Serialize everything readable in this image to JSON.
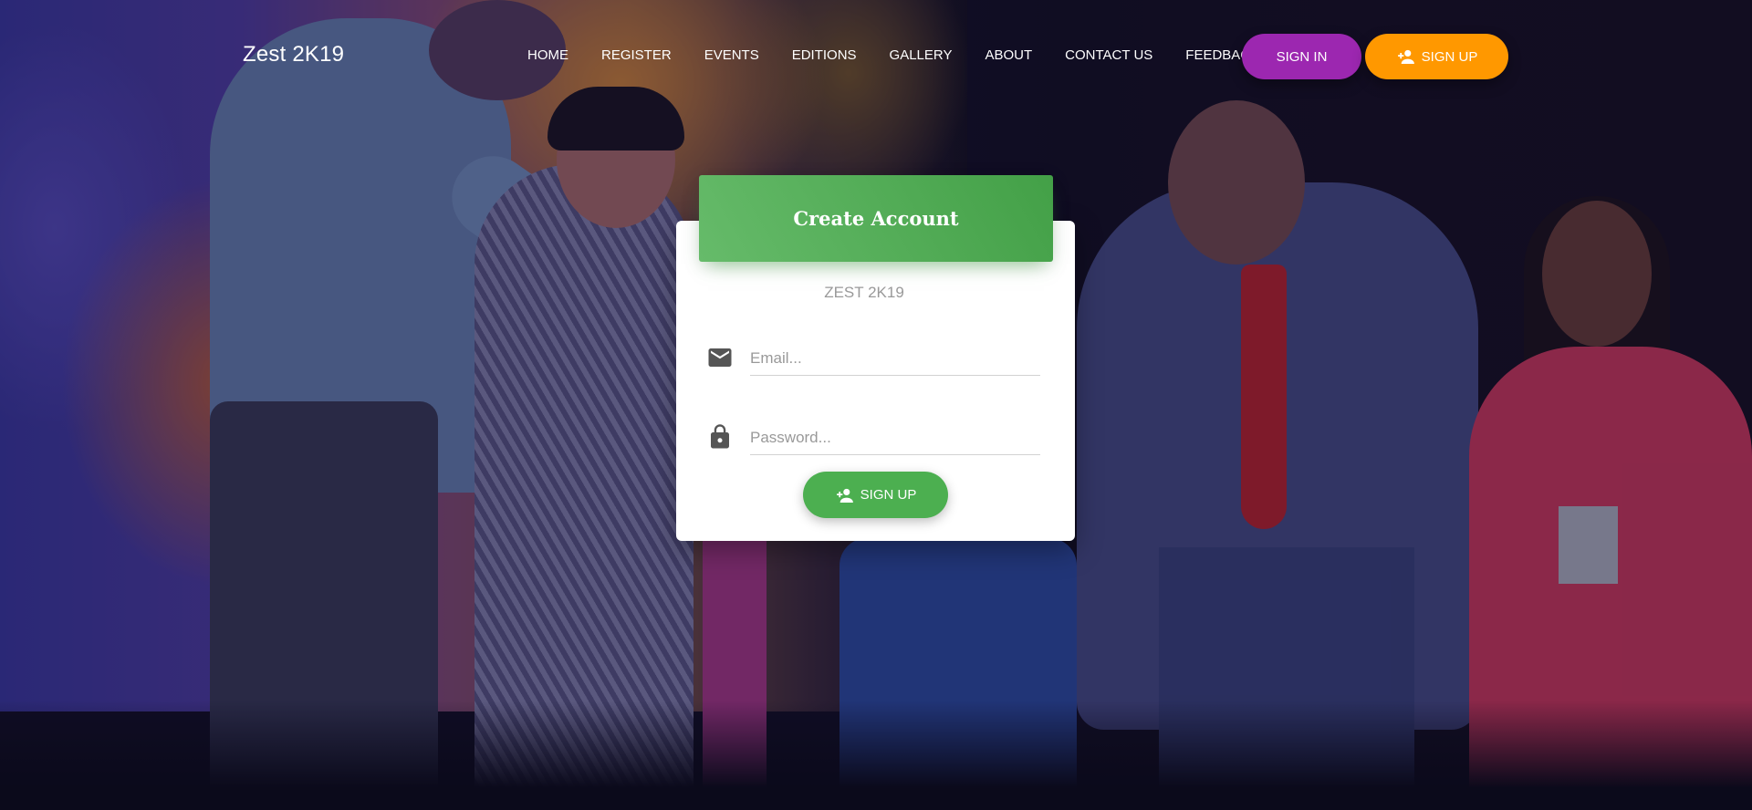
{
  "navbar": {
    "brand": "Zest 2K19",
    "links": [
      "HOME",
      "REGISTER",
      "EVENTS",
      "EDITIONS",
      "GALLERY",
      "ABOUT",
      "CONTACT US",
      "FEEDBACK"
    ],
    "signin_label": "SIGN IN",
    "signup_label": "SIGN UP",
    "signin_color": "#9c27b0",
    "signup_color": "#ff9800"
  },
  "card": {
    "title": "Create Account",
    "subtitle": "ZEST 2K19",
    "email_placeholder": "Email...",
    "password_placeholder": "Password...",
    "submit_label": "SIGN UP",
    "header_color": "#4caf50",
    "email_icon": "mail-icon",
    "password_icon": "lock-icon",
    "submit_icon": "person-add-icon"
  }
}
